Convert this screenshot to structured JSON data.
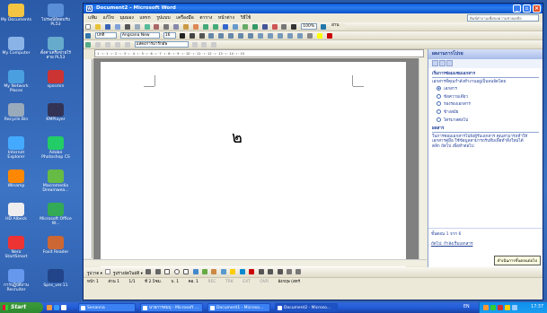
{
  "desktop": {
    "icons": [
      {
        "label": "My Documents",
        "x": 0
      },
      {
        "label": "ไปรษณีย์ตอบรับ PL53",
        "x": 0
      },
      {
        "label": "My Computer",
        "x": 0
      },
      {
        "label": "ตั้งค่าเครือข่ายไร้สาย PL53",
        "x": 0
      },
      {
        "label": "My Network Places",
        "x": 0
      },
      {
        "label": "spssmin",
        "x": 0
      },
      {
        "label": "Recycle Bin",
        "x": 0
      },
      {
        "label": "KMPlayer",
        "x": 0
      },
      {
        "label": "Internet Explorer",
        "x": 0
      },
      {
        "label": "Adobe Photoshop CS",
        "x": 0
      },
      {
        "label": "Winamp",
        "x": 0
      },
      {
        "label": "Macromedia Dreamwea...",
        "x": 0
      },
      {
        "label": "HD Albeck",
        "x": 0
      },
      {
        "label": "Microsoft Office W...",
        "x": 0
      },
      {
        "label": "Nero StartSmart",
        "x": 0
      },
      {
        "label": "Foxit Reader",
        "x": 0
      },
      {
        "label": "การปฏิบัติงาน Recruiter",
        "x": 0
      },
      {
        "label": "Spss_ver.11",
        "x": 0
      }
    ]
  },
  "word": {
    "title": "Document2 - Microsoft Word",
    "menu": [
      "แฟ้ม",
      "แก้ไข",
      "มุมมอง",
      "แทรก",
      "รูปแบบ",
      "เครื่องมือ",
      "ตาราง",
      "หน้าต่าง",
      "วิธีใช้"
    ],
    "ask_placeholder": "พิมพ์คำถามเพื่อขอความช่วยเหลือ",
    "style": "ปกติ",
    "font": "Angsana New",
    "size": "16",
    "zoom": "100%",
    "read": "อ่าน",
    "compare_label": "แสดงการมาร์กอัพ",
    "doc_char": "๒",
    "ruler_text": "· 1 · ı · 1 · ı · 2 · ı · 3 · ı · 4 · ı · 5 · ı · 6 · ı · 7 · ı · 8 · ı · 9 · ı · 10 · ı · 11 · ı · 12 · ı · 13 · ı · 14 · ı · 15",
    "drawbar": {
      "draw_label": "รูปวาด ▾",
      "autoshapes": "รูปร่างอัตโนมัติ ▾"
    },
    "status": [
      "หน้า 1",
      "ส่วน 1",
      "1/1",
      "ที่ 2.5ซม.",
      "บ. 1",
      "คอ. 1",
      "REC",
      "TRK",
      "EXT",
      "OVR",
      "อังกฤษ (สหรั"
    ],
    "taskpane": {
      "title": "ผลงานการโปรย",
      "section1": "เริ่มการซ่อมเเซมเอกสาร",
      "section1_text": "เอกสารที่คุณกำลังทำงานอยู่เป็นจนจัดโดย",
      "options": [
        "เอกสาร",
        "ข้อความเดียว",
        "รองรองเอกสาร",
        "ข้างสมัย",
        "ไตรมาสต่อไป"
      ],
      "section2": "ผลสาร",
      "section2_text": "ในการซ่อมเอกสารไปยังผู้รับเอกสาร คุณสามารถทำให้เอกสารคู่มือ ใช้ข้อมูลสามารถรับทีมเพื่อทำสิ่งใหม่ได้",
      "section2_link": "คลิก ถัดไป เพื่อทำต่อไป",
      "step": "ขั้นตอน 1 จาก 6",
      "next": "ถัดไป: กำลังเริ่มเอกสาร",
      "tooltip": "ดำเนินการขั้นตอนต่อไป"
    }
  },
  "taskbar": {
    "start": "Start",
    "tasks": [
      "Senanna",
      "นายการสมบุ - Microsoft ...",
      "Document1 - Microso...",
      "Document2 - Microso..."
    ],
    "tray_lang": "EN",
    "clock": "17:37"
  },
  "colors": {
    "xp_blue": "#245edb",
    "start_green": "#3c9a3c",
    "title": "#0a5bd8"
  }
}
